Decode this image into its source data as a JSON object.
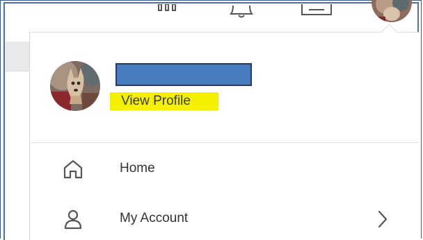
{
  "topbar": {
    "icons": [
      "grid-icon",
      "bell-icon",
      "inbox-icon"
    ],
    "avatar": "user-avatar"
  },
  "profile": {
    "name_redacted": "",
    "link_label": "View Profile",
    "highlight_color": "#f4f000",
    "redaction_color": "#4a7dbf"
  },
  "menu": {
    "items": [
      {
        "label": "Home",
        "icon": "home-icon",
        "has_submenu": false
      },
      {
        "label": "My Account",
        "icon": "user-icon",
        "has_submenu": true
      }
    ]
  }
}
